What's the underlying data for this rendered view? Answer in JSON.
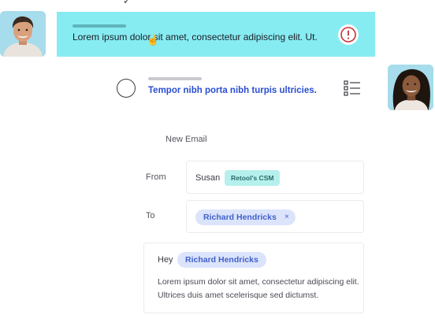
{
  "alert": {
    "message": "Lorem ipsum dolor sit amet, consectetur adipiscing elit. Ut.",
    "icon": "exclamation-circle-icon",
    "accent": "#86ecf2"
  },
  "task": {
    "label": "Tempor nibh porta nibh turpis ultricies.",
    "label_color": "#2a4ed1"
  },
  "compose": {
    "title": "New Email",
    "from_label": "From",
    "from_name": "Susan",
    "from_badge": "Retool's CSM",
    "to_label": "To",
    "to_recipient": "Richard Hendricks",
    "chip_close": "×",
    "greeting": "Hey",
    "greeting_name": "Richard Hendricks",
    "body": "Lorem ipsum dolor sit amet, consectetur adipiscing elit. Ultrices duis amet scelerisque sed dictumst."
  }
}
